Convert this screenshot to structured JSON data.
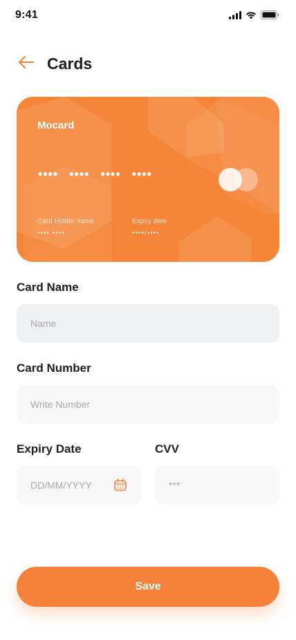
{
  "status_bar": {
    "time": "9:41",
    "icons": [
      "signal-icon",
      "wifi-icon",
      "battery-icon"
    ]
  },
  "header": {
    "title": "Cards",
    "back_icon": "arrow-left-icon"
  },
  "card": {
    "brand": "Mocard",
    "number_groups": [
      "••••",
      "••••",
      "••••",
      "••••"
    ],
    "holder_label": "Card Holder name",
    "holder_value": "•••• ••••",
    "expiry_label": "Expiry date",
    "expiry_value": "••••/••••",
    "logo_icon": "card-network-logo-icon",
    "colors": {
      "base": "#f58538",
      "accent": "#ffffff"
    }
  },
  "form": {
    "card_name": {
      "label": "Card Name",
      "placeholder": "Name",
      "value": ""
    },
    "card_number": {
      "label": "Card Number",
      "placeholder": "Write Number",
      "value": ""
    },
    "expiry_date": {
      "label": "Expiry Date",
      "placeholder": "DD/MM/YYYY",
      "value": "",
      "icon": "calendar-icon"
    },
    "cvv": {
      "label": "CVV",
      "placeholder": "***",
      "value": ""
    }
  },
  "actions": {
    "save_label": "Save"
  },
  "theme": {
    "accent": "#f6813a",
    "field_bg": "#f8f8f8",
    "field_active_bg": "#eff0f2"
  }
}
